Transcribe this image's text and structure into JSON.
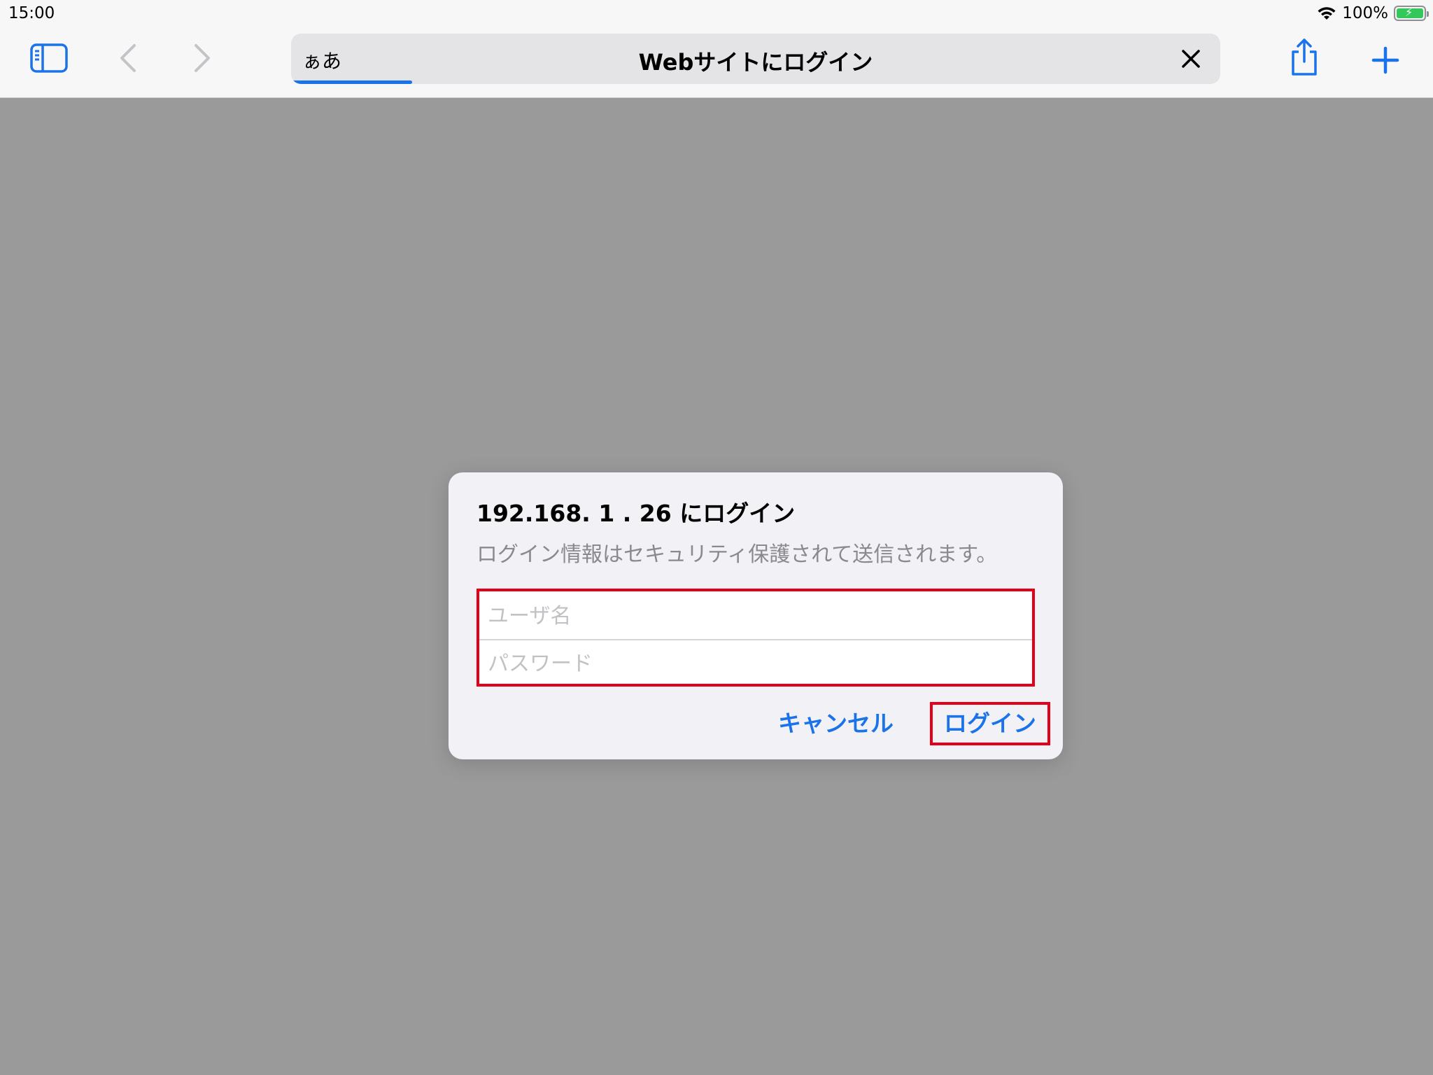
{
  "status_bar": {
    "time": "15:00",
    "battery_percent": "100%",
    "wifi_icon": "wifi-icon",
    "battery_icon": "battery-charging-icon"
  },
  "toolbar": {
    "text_size_label": "ぁあ",
    "page_title": "Webサイトにログイン",
    "icons": {
      "sidebar": "sidebar-icon",
      "back": "chevron-left-icon",
      "forward": "chevron-right-icon",
      "stop": "close-icon",
      "share": "share-icon",
      "new_tab": "plus-icon"
    },
    "load_progress": 0.13,
    "accent_color": "#1a73e8"
  },
  "dialog": {
    "title": "192.168. 1 . 26 にログイン",
    "message": "ログイン情報はセキュリティ保護されて送信されます。",
    "username_placeholder": "ユーザ名",
    "password_placeholder": "パスワード",
    "cancel_label": "キャンセル",
    "login_label": "ログイン",
    "highlight_color": "#e5001a"
  }
}
